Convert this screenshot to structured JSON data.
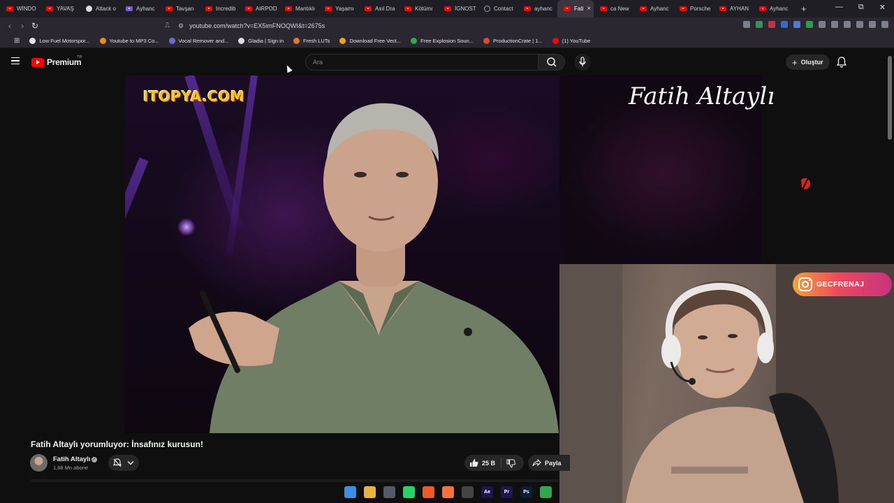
{
  "browser": {
    "tabs": [
      {
        "label": "WİNDO",
        "icon": "youtube-icon"
      },
      {
        "label": "YAVAŞ",
        "icon": "youtube-icon"
      },
      {
        "label": "Attack o",
        "icon": "github-icon"
      },
      {
        "label": "Ayhanc",
        "icon": "extension-icon"
      },
      {
        "label": "Tavşan",
        "icon": "youtube-icon"
      },
      {
        "label": "Incredib",
        "icon": "youtube-icon"
      },
      {
        "label": "AIRPOD",
        "icon": "youtube-icon"
      },
      {
        "label": "Mantıklı",
        "icon": "youtube-icon"
      },
      {
        "label": "Yaşamı",
        "icon": "youtube-icon"
      },
      {
        "label": "Asıl Dra",
        "icon": "youtube-icon"
      },
      {
        "label": "Kötümı",
        "icon": "youtube-icon"
      },
      {
        "label": "İGNOST",
        "icon": "youtube-icon"
      },
      {
        "label": "Contact",
        "icon": "globe-icon"
      },
      {
        "label": "ayhanc",
        "icon": "youtube-icon"
      },
      {
        "label": "Fati",
        "icon": "youtube-icon",
        "active": true
      },
      {
        "label": "ca New",
        "icon": "youtube-icon"
      },
      {
        "label": "Ayhanc",
        "icon": "youtube-icon"
      },
      {
        "label": "Porsche",
        "icon": "youtube-icon"
      },
      {
        "label": "AYHAN",
        "icon": "youtube-icon"
      },
      {
        "label": "Ayhanc",
        "icon": "youtube-icon"
      }
    ],
    "new_tab": "+",
    "tab_close": "×",
    "window_controls": {
      "minimize": "—",
      "restore": "⧉",
      "close": "✕"
    },
    "url": "youtube.com/watch?v=EX5imFNOQWI&t=2675s",
    "bookmarks": [
      {
        "label": "Low Fuel Motorspor...",
        "color": "#e6e6e6"
      },
      {
        "label": "Youtube to MP3 Co...",
        "color": "#f28a1a"
      },
      {
        "label": "Vocal Remover and...",
        "color": "#6b6bd6"
      },
      {
        "label": "Gladia | Sign in",
        "color": "#dddddd"
      },
      {
        "label": "Fresh LUTs",
        "color": "#e07a2a"
      },
      {
        "label": "Download Free Vect...",
        "color": "#f2a21a"
      },
      {
        "label": "Free Explosion Soun...",
        "color": "#3aa55a"
      },
      {
        "label": "ProductionCrate | 1...",
        "color": "#d84a3a"
      },
      {
        "label": "(1) YouTube",
        "color": "#ff0000"
      }
    ]
  },
  "youtube": {
    "brand": "Premium",
    "region": "TR",
    "search_placeholder": "Ara",
    "create_label": "Oluştur",
    "video": {
      "overlay_title": "Fatih Altaylı",
      "watermark": "ITOPYA.COM",
      "title": "Fatih Altaylı yorumluyor: İnsafınız kurusun!",
      "channel": "Fatih Altaylı",
      "subscribers": "1,68 Mn abone",
      "likes": "25 B",
      "share_label": "Payla"
    },
    "webcam": {
      "handle": "GECFRENAJ"
    }
  },
  "taskbar": {
    "apps": [
      {
        "name": "windows-start",
        "label": "",
        "color": "#3b8eea"
      },
      {
        "name": "file-explorer",
        "label": "",
        "color": "#e8b53a"
      },
      {
        "name": "notepad",
        "label": "",
        "color": "#555a66"
      },
      {
        "name": "whatsapp",
        "label": "",
        "color": "#25d366"
      },
      {
        "name": "brave",
        "label": "",
        "color": "#f05a24"
      },
      {
        "name": "firefox",
        "label": "",
        "color": "#ff7139"
      },
      {
        "name": "chatgpt",
        "label": "",
        "color": "#444444"
      },
      {
        "name": "after-effects",
        "label": "Ae",
        "color": "#1f1550"
      },
      {
        "name": "premiere",
        "label": "Pr",
        "color": "#1f1550"
      },
      {
        "name": "photoshop",
        "label": "Ps",
        "color": "#061e36"
      },
      {
        "name": "media-player",
        "label": "",
        "color": "#2ea84a"
      }
    ]
  }
}
